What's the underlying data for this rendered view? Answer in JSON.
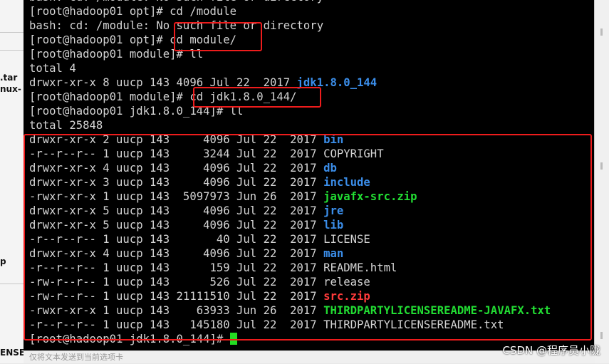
{
  "left_panel": {
    "fragments": [
      ".tar",
      "nux-",
      "p",
      "ENSE"
    ]
  },
  "terminal": {
    "lines": [
      {
        "segments": [
          {
            "text": "bash: cd: /module: No such file or directory",
            "style": "plain"
          }
        ]
      },
      {
        "segments": [
          {
            "text": "[root@hadoop01 opt]# cd /module",
            "style": "plain"
          }
        ]
      },
      {
        "segments": [
          {
            "text": "bash: cd: /module: No such file or directory",
            "style": "plain"
          }
        ]
      },
      {
        "segments": [
          {
            "text": "[root@hadoop01 opt]# cd module/",
            "style": "plain"
          }
        ]
      },
      {
        "segments": [
          {
            "text": "[root@hadoop01 module]# ll",
            "style": "plain"
          }
        ]
      },
      {
        "segments": [
          {
            "text": "total 4",
            "style": "plain"
          }
        ]
      },
      {
        "segments": [
          {
            "text": "drwxr-xr-x 8 uucp 143 4096 Jul 22  2017 ",
            "style": "plain"
          },
          {
            "text": "jdk1.8.0_144",
            "style": "dir"
          }
        ]
      },
      {
        "segments": [
          {
            "text": "[root@hadoop01 module]# cd jdk1.8.0_144/",
            "style": "plain"
          }
        ]
      },
      {
        "segments": [
          {
            "text": "[root@hadoop01 jdk1.8.0_144]# ll",
            "style": "plain"
          }
        ]
      },
      {
        "segments": [
          {
            "text": "total 25848",
            "style": "plain"
          }
        ]
      },
      {
        "segments": [
          {
            "text": "drwxr-xr-x 2 uucp 143     4096 Jul 22  2017 ",
            "style": "plain"
          },
          {
            "text": "bin",
            "style": "dir"
          }
        ]
      },
      {
        "segments": [
          {
            "text": "-r--r--r-- 1 uucp 143     3244 Jul 22  2017 COPYRIGHT",
            "style": "plain"
          }
        ]
      },
      {
        "segments": [
          {
            "text": "drwxr-xr-x 4 uucp 143     4096 Jul 22  2017 ",
            "style": "plain"
          },
          {
            "text": "db",
            "style": "dir"
          }
        ]
      },
      {
        "segments": [
          {
            "text": "drwxr-xr-x 3 uucp 143     4096 Jul 22  2017 ",
            "style": "plain"
          },
          {
            "text": "include",
            "style": "dir"
          }
        ]
      },
      {
        "segments": [
          {
            "text": "-rwxr-xr-x 1 uucp 143  5097973 Jun 26  2017 ",
            "style": "plain"
          },
          {
            "text": "javafx-src.zip",
            "style": "exe"
          }
        ]
      },
      {
        "segments": [
          {
            "text": "drwxr-xr-x 5 uucp 143     4096 Jul 22  2017 ",
            "style": "plain"
          },
          {
            "text": "jre",
            "style": "dir"
          }
        ]
      },
      {
        "segments": [
          {
            "text": "drwxr-xr-x 5 uucp 143     4096 Jul 22  2017 ",
            "style": "plain"
          },
          {
            "text": "lib",
            "style": "dir"
          }
        ]
      },
      {
        "segments": [
          {
            "text": "-r--r--r-- 1 uucp 143       40 Jul 22  2017 LICENSE",
            "style": "plain"
          }
        ]
      },
      {
        "segments": [
          {
            "text": "drwxr-xr-x 4 uucp 143     4096 Jul 22  2017 ",
            "style": "plain"
          },
          {
            "text": "man",
            "style": "dir"
          }
        ]
      },
      {
        "segments": [
          {
            "text": "-r--r--r-- 1 uucp 143      159 Jul 22  2017 README.html",
            "style": "plain"
          }
        ]
      },
      {
        "segments": [
          {
            "text": "-rw-r--r-- 1 uucp 143      526 Jul 22  2017 release",
            "style": "plain"
          }
        ]
      },
      {
        "segments": [
          {
            "text": "-rw-r--r-- 1 uucp 143 21111510 Jul 22  2017 ",
            "style": "plain"
          },
          {
            "text": "src.zip",
            "style": "arc"
          }
        ]
      },
      {
        "segments": [
          {
            "text": "-rwxr-xr-x 1 uucp 143    63933 Jun 26  2017 ",
            "style": "plain"
          },
          {
            "text": "THIRDPARTYLICENSEREADME-JAVAFX.txt",
            "style": "exe"
          }
        ]
      },
      {
        "segments": [
          {
            "text": "-r--r--r-- 1 uucp 143   145180 Jul 22  2017 THIRDPARTYLICENSEREADME.txt",
            "style": "plain"
          }
        ]
      },
      {
        "segments": [
          {
            "text": "[root@hadoop01 jdk1.8.0_144]# ",
            "style": "plain"
          }
        ],
        "cursor": true
      }
    ],
    "colors": {
      "background": "#000000",
      "text": "#d4d4d4",
      "dir": "#3b8eea",
      "exe": "#22dd33",
      "arc": "#ff3b3b",
      "highlight": "#ee1c1c",
      "cursor": "#22dd22"
    }
  },
  "bottom_bar": {
    "text": "仅将文本发送到当前选项卡"
  },
  "watermark": "CSDN @程序员小陇"
}
